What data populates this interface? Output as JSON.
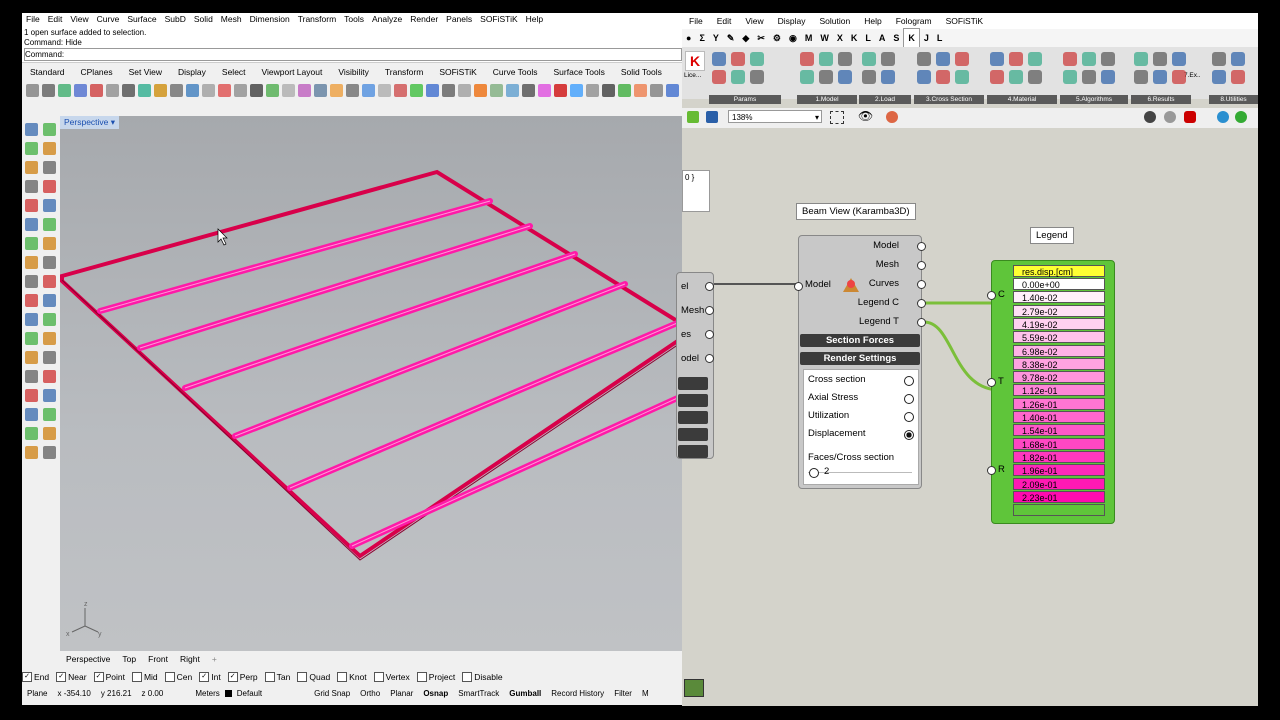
{
  "rhino": {
    "menu": [
      "File",
      "Edit",
      "View",
      "Curve",
      "Surface",
      "SubD",
      "Solid",
      "Mesh",
      "Dimension",
      "Transform",
      "Tools",
      "Analyze",
      "Render",
      "Panels",
      "SOFiSTiK",
      "Help"
    ],
    "command_history": [
      "1 open surface added to selection.",
      "Command: Hide"
    ],
    "command_prompt": "Command:",
    "toolbar_tabs": [
      "Standard",
      "CPlanes",
      "Set View",
      "Display",
      "Select",
      "Viewport Layout",
      "Visibility",
      "Transform",
      "SOFiSTiK",
      "Curve Tools",
      "Surface Tools",
      "Solid Tools"
    ],
    "viewport_title": "Perspective",
    "view_tabs": [
      "Perspective",
      "Top",
      "Front",
      "Right"
    ],
    "view_tab_add": "+",
    "osnaps": [
      {
        "label": "End",
        "checked": true
      },
      {
        "label": "Near",
        "checked": true
      },
      {
        "label": "Point",
        "checked": true
      },
      {
        "label": "Mid",
        "checked": false
      },
      {
        "label": "Cen",
        "checked": false
      },
      {
        "label": "Int",
        "checked": true
      },
      {
        "label": "Perp",
        "checked": true
      },
      {
        "label": "Tan",
        "checked": false
      },
      {
        "label": "Quad",
        "checked": false
      },
      {
        "label": "Knot",
        "checked": false
      },
      {
        "label": "Vertex",
        "checked": false
      },
      {
        "label": "Project",
        "checked": false
      },
      {
        "label": "Disable",
        "checked": false
      }
    ],
    "status": {
      "plane": "Plane",
      "x": "x -354.10",
      "y": "y 216.21",
      "z": "z 0.00",
      "units": "Meters",
      "layer": "Default",
      "toggles": [
        "Grid Snap",
        "Ortho",
        "Planar",
        "Osnap",
        "SmartTrack",
        "Gumball",
        "Record History",
        "Filter",
        "M"
      ]
    },
    "axis_labels": {
      "z": "z",
      "y": "y",
      "x": "x"
    }
  },
  "grasshopper": {
    "menu": [
      "File",
      "Edit",
      "View",
      "Display",
      "Solution",
      "Help",
      "Fologram",
      "SOFiSTiK"
    ],
    "tabs": [
      "Σ",
      "Y",
      "✎",
      "◆",
      "✂",
      "⚙",
      "◉",
      "M",
      "W",
      "X",
      "K",
      "L",
      "A",
      "S",
      "K",
      "J",
      "L"
    ],
    "ribbon_groups": [
      "Params",
      "1.Model",
      "2.Load",
      "3.Cross Section",
      "4.Material",
      "5.Algorithms",
      "6.Results",
      "8.Utilities"
    ],
    "ribbon_lic": "Lice...",
    "ribbon_ex": "7.Ex..",
    "zoom": "138%",
    "partial_panel": "0 }",
    "left_comp_outputs": [
      "el",
      "Mesh",
      "es",
      "odel"
    ],
    "beam_view": {
      "title": "Beam View (Karamba3D)",
      "input": "Model",
      "outputs": [
        "Model",
        "Mesh",
        "Curves",
        "Legend C",
        "Legend T"
      ],
      "section_forces": "Section Forces",
      "render_settings": "Render Settings",
      "options": [
        {
          "label": "Cross section",
          "selected": false
        },
        {
          "label": "Axial Stress",
          "selected": false
        },
        {
          "label": "Utilization",
          "selected": false
        },
        {
          "label": "Displacement",
          "selected": true
        }
      ],
      "faces_label": "Faces/Cross section",
      "slider_value": "2"
    },
    "legend": {
      "title": "Legend",
      "inputs": [
        "C",
        "T",
        "R"
      ],
      "header": "res.disp.[cm]",
      "values": [
        "0.00e+00",
        "1.40e-02",
        "2.79e-02",
        "4.19e-02",
        "5.59e-02",
        "6.98e-02",
        "8.38e-02",
        "9.78e-02",
        "1.12e-01",
        "1.26e-01",
        "1.40e-01",
        "1.54e-01",
        "1.68e-01",
        "1.82e-01",
        "1.96e-01",
        "2.09e-01",
        "2.23e-01"
      ],
      "colors": [
        "#ffffff",
        "#fff0fa",
        "#ffe0f5",
        "#ffd1f0",
        "#ffc2eb",
        "#ffb2e6",
        "#ffa3e1",
        "#ff94dc",
        "#ff85d7",
        "#ff75d2",
        "#ff66cd",
        "#ff57c8",
        "#ff47c3",
        "#ff38be",
        "#ff29b9",
        "#ff19b4",
        "#ff0aaf"
      ],
      "header_color": "#ffff33"
    }
  }
}
